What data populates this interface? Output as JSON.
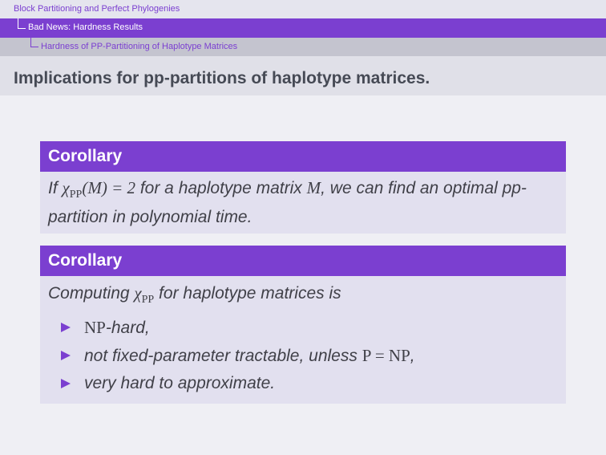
{
  "header": {
    "breadcrumb": [
      "Block Partitioning and Perfect Phylogenies",
      "Bad News: Hardness Results",
      "Hardness of PP-Partitioning of Haplotype Matrices"
    ]
  },
  "title": "Implications for pp-partitions of haplotype matrices.",
  "corollary1": {
    "heading": "Corollary",
    "t1": "If ",
    "chi": "χ",
    "sub": "PP",
    "math": "(M) = 2",
    "t2": " for a haplotype matrix ",
    "m": "M",
    "t3": ", we can find an optimal pp-partition in polynomial time."
  },
  "corollary2": {
    "heading": "Corollary",
    "intro1": "Computing ",
    "chi": "χ",
    "sub": "PP",
    "intro2": " for haplotype matrices is",
    "items": [
      {
        "rm": "NP",
        "text": "-hard,"
      },
      {
        "text": "not fixed-parameter tractable, unless ",
        "rm": "P = NP",
        "end": ","
      },
      {
        "text": "very hard to approximate."
      }
    ]
  },
  "colors": {
    "accent": "#7b3fd0",
    "block_body": "#e2e0ef",
    "background": "#efeff4"
  }
}
